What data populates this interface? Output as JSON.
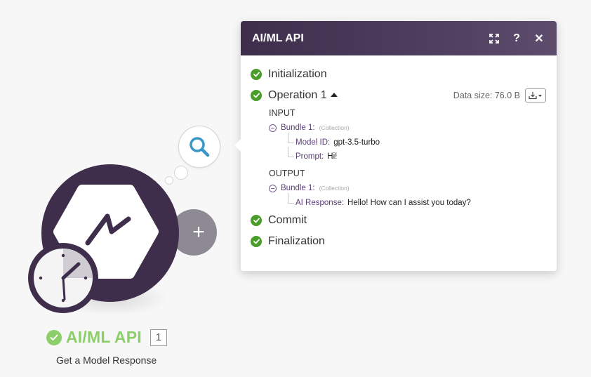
{
  "panel": {
    "title": "AI/ML API",
    "data_size": "Data size: 76.0 B",
    "header_icons": [
      "expand-icon",
      "help-icon",
      "close-icon"
    ],
    "steps": [
      {
        "label": "Initialization"
      },
      {
        "label": "Operation 1"
      },
      {
        "label": "Commit"
      },
      {
        "label": "Finalization"
      }
    ],
    "input": {
      "title": "INPUT",
      "bundle_name": "Bundle 1:",
      "bundle_type": "(Collection)",
      "fields": [
        {
          "key": "Model ID:",
          "value": "gpt-3.5-turbo"
        },
        {
          "key": "Prompt:",
          "value": "Hi!"
        }
      ]
    },
    "output": {
      "title": "OUTPUT",
      "bundle_name": "Bundle 1:",
      "bundle_type": "(Collection)",
      "fields": [
        {
          "key": "AI Response:",
          "value": "Hello! How can I assist you today?"
        }
      ]
    }
  },
  "module": {
    "name": "AI/ML API",
    "operations_count": "1",
    "subtitle": "Get a Model Response",
    "add_symbol": "+"
  },
  "colors": {
    "module_dark": "#3e2e4c",
    "success_green": "#4a9d2a",
    "label_green": "#8ccf6a",
    "bundle_purple": "#5b3d7a",
    "search_blue": "#3a97c9"
  }
}
